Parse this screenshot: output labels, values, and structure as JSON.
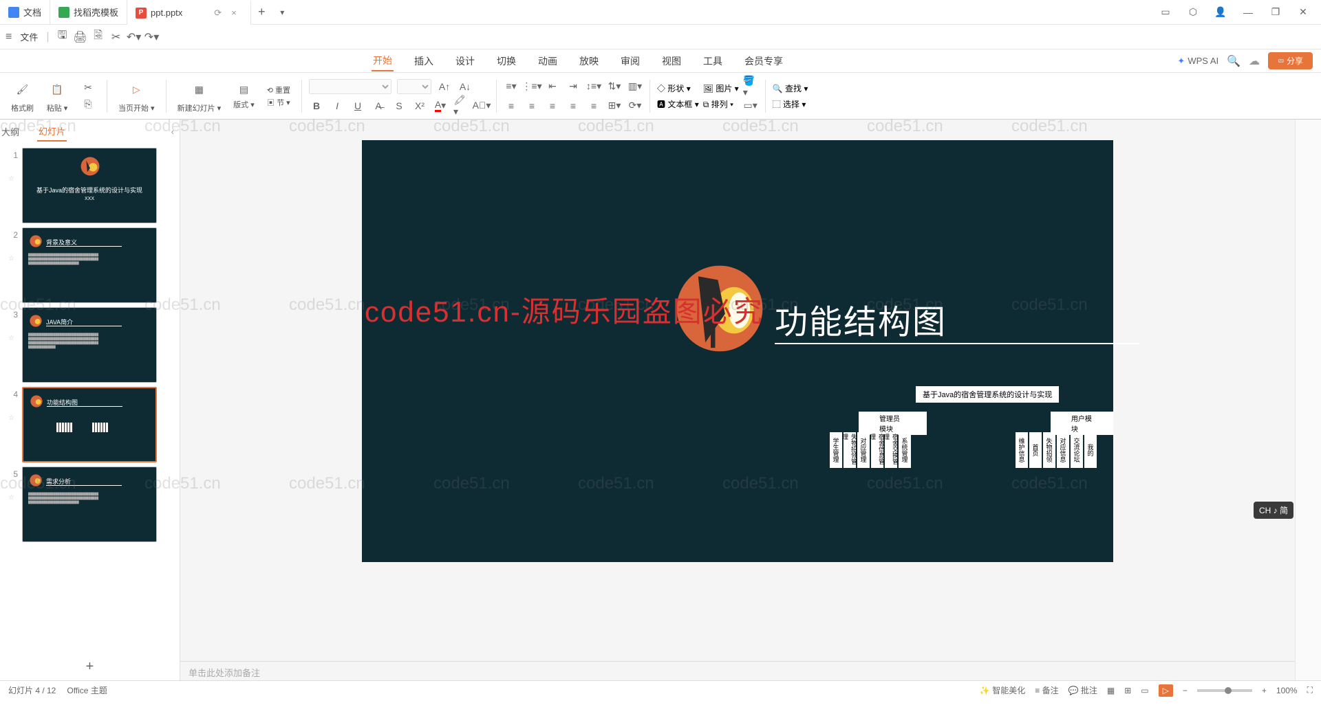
{
  "tabs": {
    "doc": "文档",
    "search": "找稻壳模板",
    "ppt": "ppt.pptx",
    "ppt_badge": "P"
  },
  "menu": {
    "file": "文件"
  },
  "ribbon_tabs": {
    "start": "开始",
    "insert": "插入",
    "design": "设计",
    "transition": "切换",
    "animation": "动画",
    "slideshow": "放映",
    "review": "审阅",
    "view": "视图",
    "tools": "工具",
    "vip": "会员专享",
    "ai": "WPS AI"
  },
  "share": "分享",
  "ribbon": {
    "format_painter": "格式刷",
    "paste": "粘贴",
    "start_from": "当页开始",
    "new_slide": "新建幻灯片",
    "layout": "版式",
    "section": "节",
    "reset": "重置",
    "shape": "形状",
    "picture": "图片",
    "textbox": "文本框",
    "arrange": "排列",
    "find": "查找",
    "select": "选择"
  },
  "sidebar": {
    "outline": "大纲",
    "slides": "幻灯片"
  },
  "thumbs": [
    {
      "num": "1",
      "title": "基于Java的宿舍管理系统的设计与实现",
      "sub": "XXX"
    },
    {
      "num": "2",
      "title": "背景及意义"
    },
    {
      "num": "3",
      "title": "JAVA简介"
    },
    {
      "num": "4",
      "title": "功能结构图"
    },
    {
      "num": "5",
      "title": "需求分析"
    }
  ],
  "slide": {
    "title": "功能结构图",
    "root": "基于Java的宿舍管理系统的设计与实现",
    "mid": [
      "管理员模块",
      "用户模块"
    ],
    "leaves_left": [
      "学生管理",
      "失物招领管理",
      "对应管理",
      "宿舍信息管理",
      "宿舍交换管理",
      "系统管理"
    ],
    "leaves_right": [
      "维护信息",
      "首页",
      "失物招领",
      "对应信息",
      "交流论坛",
      "我的"
    ]
  },
  "notes": "单击此处添加备注",
  "ime": "CH ♪ 简",
  "status": {
    "slide": "幻灯片 4 / 12",
    "office": "Office 主题",
    "beautify": "智能美化",
    "notes": "备注",
    "comments": "批注",
    "zoom": "100%"
  },
  "watermark_text": "code51.cn",
  "red_wm": "code51.cn-源码乐园盗图必究"
}
